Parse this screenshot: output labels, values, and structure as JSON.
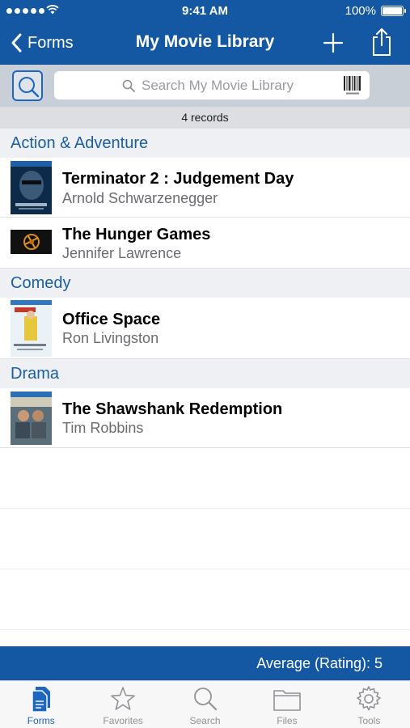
{
  "status_bar": {
    "time": "9:41 AM",
    "battery": "100%"
  },
  "nav": {
    "back_label": "Forms",
    "title": "My Movie Library"
  },
  "search": {
    "placeholder": "Search My Movie Library"
  },
  "records_count": "4 records",
  "sections": [
    {
      "name": "Action & Adventure",
      "items": [
        {
          "title": "Terminator 2 : Judgement Day",
          "subtitle": "Arnold Schwarzenegger"
        },
        {
          "title": "The Hunger Games",
          "subtitle": "Jennifer Lawrence"
        }
      ]
    },
    {
      "name": "Comedy",
      "items": [
        {
          "title": "Office Space",
          "subtitle": "Ron Livingston"
        }
      ]
    },
    {
      "name": "Drama",
      "items": [
        {
          "title": "The Shawshank Redemption",
          "subtitle": "Tim Robbins"
        }
      ]
    }
  ],
  "summary": "Average (Rating): 5",
  "tabs": [
    {
      "label": "Forms",
      "icon": "forms-icon",
      "active": true
    },
    {
      "label": "Favorites",
      "icon": "star-icon",
      "active": false
    },
    {
      "label": "Search",
      "icon": "search-icon",
      "active": false
    },
    {
      "label": "Files",
      "icon": "folder-icon",
      "active": false
    },
    {
      "label": "Tools",
      "icon": "gear-icon",
      "active": false
    }
  ],
  "colors": {
    "brand": "#1458a3",
    "section_header_text": "#1a5fa6",
    "active_tab": "#1d66c2"
  }
}
